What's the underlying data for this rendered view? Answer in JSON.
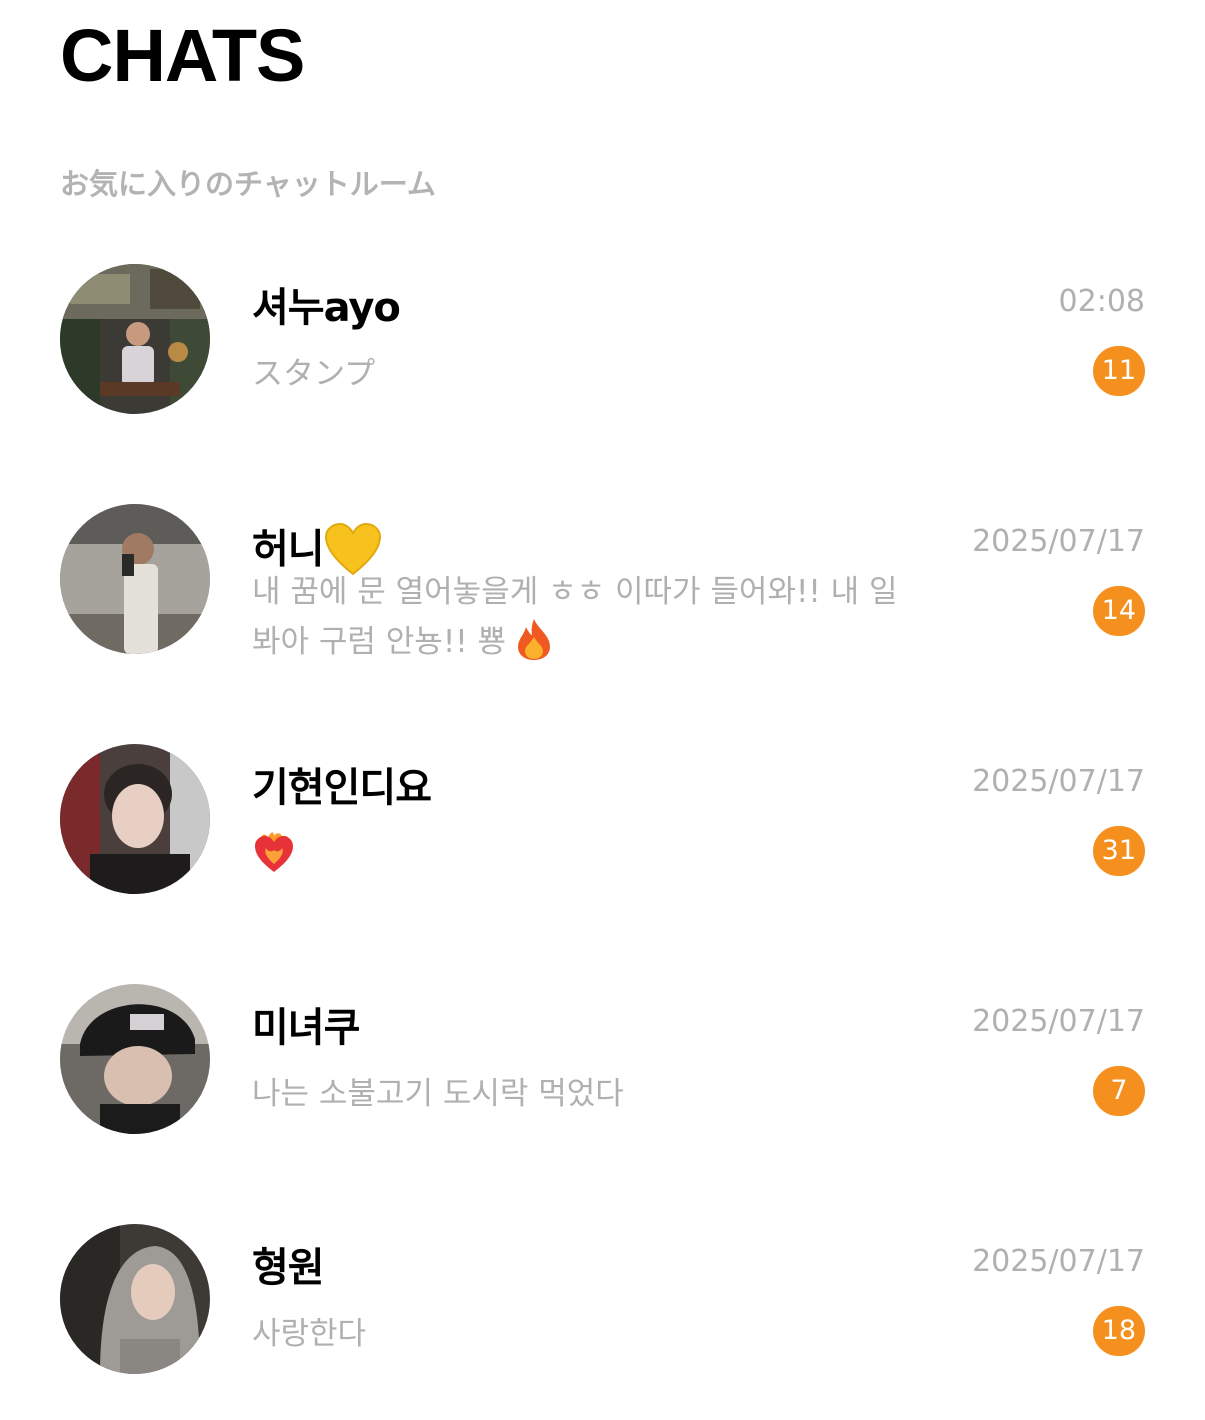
{
  "header": {
    "title": "CHATS",
    "section_title": "お気に入りのチャットルーム"
  },
  "chats": [
    {
      "name": "셔누ayo",
      "preview": "スタンプ",
      "time": "02:08",
      "unread": "11"
    },
    {
      "name": "허니",
      "name_emoji": "yellow-heart-icon",
      "preview": "내 꿈에 문 열어놓을게 ㅎㅎ 이따가 들어와!! 내 일봐아 구럼 안뇽!! 뿅",
      "preview_emoji": "fire-icon",
      "time": "2025/07/17",
      "unread": "14"
    },
    {
      "name": "기현인디요",
      "preview": "",
      "preview_emoji": "heart-on-fire-icon",
      "time": "2025/07/17",
      "unread": "31"
    },
    {
      "name": "미녀쿠",
      "preview": "나는 소불고기 도시락 먹었다",
      "time": "2025/07/17",
      "unread": "7"
    },
    {
      "name": "형원",
      "preview": "사랑한다",
      "time": "2025/07/17",
      "unread": "18"
    }
  ],
  "colors": {
    "badge": "#f5901e",
    "secondary_text": "#b0b0b0",
    "section_title": "#b3b3b3"
  }
}
